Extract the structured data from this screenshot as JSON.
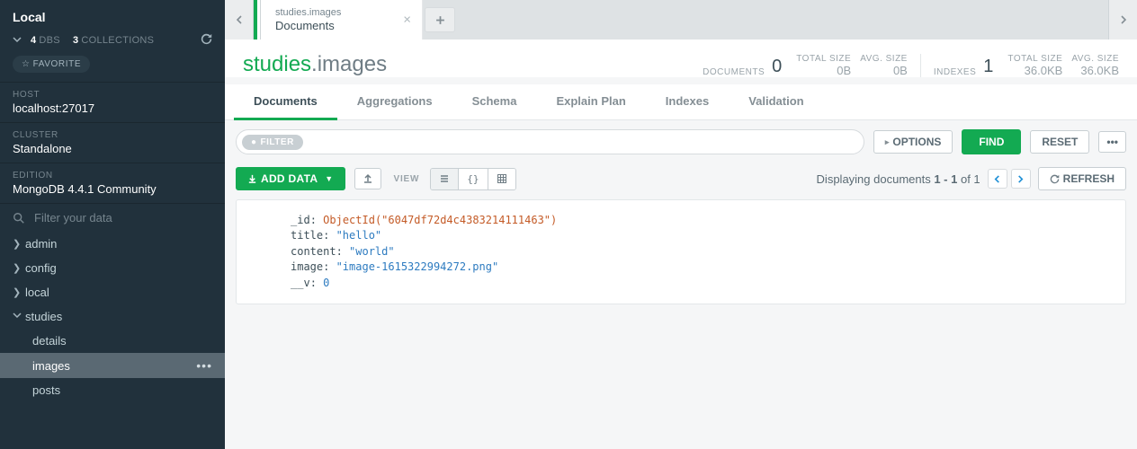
{
  "sidebar": {
    "title": "Local",
    "dbs_count": "4",
    "dbs_label": "DBS",
    "coll_count": "3",
    "coll_label": "COLLECTIONS",
    "favorite_label": "FAVORITE",
    "host_label": "HOST",
    "host_value": "localhost:27017",
    "cluster_label": "CLUSTER",
    "cluster_value": "Standalone",
    "edition_label": "EDITION",
    "edition_value": "MongoDB 4.4.1 Community",
    "filter_placeholder": "Filter your data",
    "tree": {
      "admin": "admin",
      "config": "config",
      "local": "local",
      "studies": "studies",
      "details": "details",
      "images": "images",
      "posts": "posts"
    }
  },
  "tabstrip": {
    "tab_title": "studies.images",
    "tab_sub": "Documents"
  },
  "ns": {
    "db": "studies",
    "coll": ".images"
  },
  "stats": {
    "documents_label": "DOCUMENTS",
    "documents_val": "0",
    "tot_label": "TOTAL SIZE",
    "tot_val": "0B",
    "avg_label": "AVG. SIZE",
    "avg_val": "0B",
    "indexes_label": "INDEXES",
    "indexes_val": "1",
    "idx_tot_val": "36.0KB",
    "idx_avg_val": "36.0KB"
  },
  "doctabs": {
    "documents": "Documents",
    "aggregations": "Aggregations",
    "schema": "Schema",
    "explain": "Explain Plan",
    "indexes": "Indexes",
    "validation": "Validation"
  },
  "filterbar": {
    "filter_label": "FILTER",
    "options_label": "OPTIONS",
    "find_label": "FIND",
    "reset_label": "RESET"
  },
  "toolbar": {
    "add_label": "ADD DATA",
    "view_label": "VIEW",
    "display_prefix": "Displaying documents ",
    "display_range": "1 - 1",
    "display_of": " of 1",
    "refresh_label": "REFRESH"
  },
  "document": {
    "id_key": "_id",
    "id_func": "ObjectId(",
    "id_val": "\"6047df72d4c4383214111463\"",
    "id_close": ")",
    "title_key": "title",
    "title_val": "\"hello\"",
    "content_key": "content",
    "content_val": "\"world\"",
    "image_key": "image",
    "image_val": "\"image-1615322994272.png\"",
    "v_key": "__v",
    "v_val": "0"
  }
}
